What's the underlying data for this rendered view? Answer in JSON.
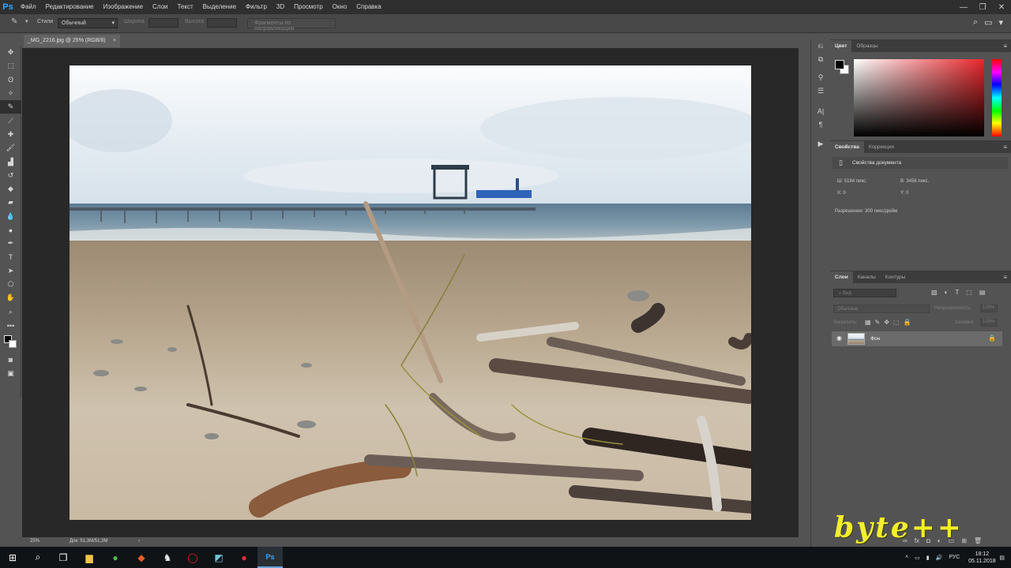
{
  "app": {
    "logo": "Ps"
  },
  "menu": [
    "Файл",
    "Редактирование",
    "Изображение",
    "Слои",
    "Текст",
    "Выделение",
    "Фильтр",
    "3D",
    "Просмотр",
    "Окно",
    "Справка"
  ],
  "window_controls": {
    "minimize": "—",
    "restore": "❐",
    "close": "✕"
  },
  "options": {
    "style_label": "Стили",
    "style_value": "Обычный",
    "width_label": "Ширина",
    "height_label": "Высота",
    "edges_button": "Фрагменты по направляющим"
  },
  "document": {
    "tab_title": "_MG_2216.jpg @ 25% (RGB/8)",
    "close": "×",
    "zoom": "25%",
    "size": "Док: 51,3M/51,3M",
    "status_arrow": "›"
  },
  "color_panel": {
    "tabs": [
      "Цвет",
      "Образцы"
    ],
    "active": 0
  },
  "properties_panel": {
    "tabs": [
      "Свойства",
      "Коррекция"
    ],
    "title": "Свойства документа",
    "width": "Ш:  5184 пикс.",
    "height": "В:  3456 пикс.",
    "x": "X:  0",
    "y": "Y:  0",
    "resolution": "Разрешение: 300 пикс/дюйм"
  },
  "layers_panel": {
    "tabs": [
      "Слои",
      "Каналы",
      "Контуры"
    ],
    "filter_placeholder": "Вид",
    "blend_mode": "Обычные",
    "opacity_label": "Непрозрачность:",
    "opacity_value": "100%",
    "lock_label": "Закрепить:",
    "fill_label": "Заливка:",
    "fill_value": "100%",
    "layer_name": "Фон"
  },
  "watermark": "byte++",
  "taskbar": {
    "lang": "РУС",
    "time": "18:12",
    "date": "05.11.2018"
  },
  "icons": {
    "tools": [
      "move-icon",
      "marquee-icon",
      "lasso-icon",
      "magic-wand-icon",
      "slice-icon",
      "eyedropper-icon",
      "healing-brush-icon",
      "brush-icon",
      "stamp-icon",
      "history-brush-icon",
      "eraser-icon",
      "gradient-icon",
      "blur-icon",
      "dodge-icon",
      "pen-icon",
      "type-icon",
      "path-select-icon",
      "shape-icon",
      "hand-icon",
      "zoom-icon",
      "more-tools-icon"
    ]
  }
}
